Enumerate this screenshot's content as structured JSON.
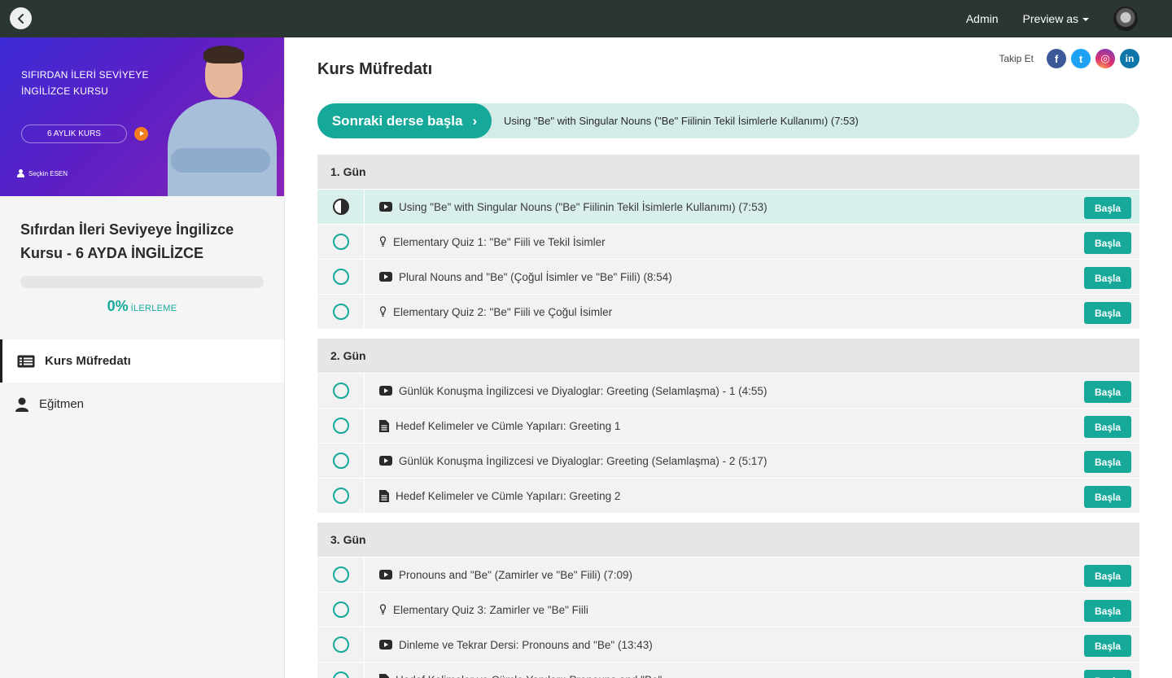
{
  "topbar": {
    "nav": [
      {
        "label": "Admin"
      },
      {
        "label": "Preview as"
      }
    ]
  },
  "banner": {
    "title_line1": "SIFIRDAN İLERİ SEVİYEYE",
    "title_line2": "İNGİLİZCE KURSU",
    "pill": "6 AYLIK KURS",
    "author": "Seçkin ESEN"
  },
  "course": {
    "title": "Sıfırdan İleri Seviyeye İngilizce Kursu - 6 AYDA İNGİLİZCE",
    "progress_percent": 0,
    "progress_value": "0%",
    "progress_label": "İLERLEME"
  },
  "sidebar": {
    "items": [
      {
        "label": "Kurs Müfredatı",
        "icon": "list-icon"
      },
      {
        "label": "Eğitmen",
        "icon": "user-icon"
      }
    ]
  },
  "main": {
    "title": "Kurs Müfredatı",
    "follow_label": "Takip Et",
    "social": [
      {
        "name": "facebook-icon",
        "glyph": "f"
      },
      {
        "name": "twitter-icon",
        "glyph": "t"
      },
      {
        "name": "instagram-icon",
        "glyph": "◎"
      },
      {
        "name": "linkedin-icon",
        "glyph": "in"
      }
    ],
    "next_button": "Sonraki derse başla",
    "next_arrow": "›",
    "next_lesson": "Using \"Be\" with Singular Nouns (\"Be\" Fiilinin Tekil İsimlerle Kullanımı) (7:53)",
    "start_label": "Başla"
  },
  "sections": [
    {
      "title": "1. Gün",
      "lessons": [
        {
          "title": "Using \"Be\" with Singular Nouns (\"Be\" Fiilinin Tekil İsimlerle Kullanımı) (7:53)",
          "type": "video",
          "status": "in-progress"
        },
        {
          "title": "Elementary Quiz 1: \"Be\" Fiili ve Tekil İsimler",
          "type": "quiz",
          "status": "not-started"
        },
        {
          "title": "Plural Nouns and \"Be\" (Çoğul İsimler ve \"Be\" Fiili) (8:54)",
          "type": "video",
          "status": "not-started"
        },
        {
          "title": "Elementary Quiz 2: \"Be\" Fiili ve Çoğul İsimler",
          "type": "quiz",
          "status": "not-started"
        }
      ]
    },
    {
      "title": "2. Gün",
      "lessons": [
        {
          "title": "Günlük Konuşma İngilizcesi ve Diyaloglar: Greeting (Selamlaşma) - 1 (4:55)",
          "type": "video",
          "status": "not-started"
        },
        {
          "title": "Hedef Kelimeler ve Cümle Yapıları: Greeting 1",
          "type": "text",
          "status": "not-started"
        },
        {
          "title": "Günlük Konuşma İngilizcesi ve Diyaloglar: Greeting (Selamlaşma) - 2 (5:17)",
          "type": "video",
          "status": "not-started"
        },
        {
          "title": "Hedef Kelimeler ve Cümle Yapıları: Greeting 2",
          "type": "text",
          "status": "not-started"
        }
      ]
    },
    {
      "title": "3. Gün",
      "lessons": [
        {
          "title": "Pronouns and \"Be\" (Zamirler ve \"Be\" Fiili) (7:09)",
          "type": "video",
          "status": "not-started"
        },
        {
          "title": "Elementary Quiz 3: Zamirler ve \"Be\" Fiili",
          "type": "quiz",
          "status": "not-started"
        },
        {
          "title": "Dinleme ve Tekrar Dersi: Pronouns and \"Be\" (13:43)",
          "type": "video",
          "status": "not-started"
        },
        {
          "title": "Hedef Kelimeler ve Cümle Yapıları: Pronouns and \"Be\"",
          "type": "text",
          "status": "not-started"
        }
      ]
    }
  ],
  "colors": {
    "accent": "#16a99a",
    "topbar": "#2b3532",
    "current_row": "#d9efeb",
    "next_bar": "#d4ece8"
  }
}
